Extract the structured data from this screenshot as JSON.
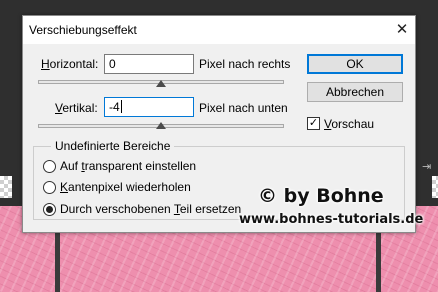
{
  "dialog": {
    "title": "Verschiebungseffekt",
    "close_symbol": "✕",
    "horizontal": {
      "label_accel": "H",
      "label_rest": "orizontal:",
      "value": "0",
      "unit_label": "Pixel nach rechts",
      "slider_level": 0.5
    },
    "vertical": {
      "label_accel": "V",
      "label_rest": "ertikal:",
      "value": "-4",
      "unit_label": "Pixel nach unten",
      "slider_level": 0.5
    },
    "buttons": {
      "ok": "OK",
      "cancel": "Abbrechen"
    },
    "preview": {
      "label_accel": "V",
      "label_rest": "orschau",
      "checked": true,
      "check_mark": "✓"
    },
    "undefined_areas": {
      "title": "Undefinierte Bereiche",
      "options": [
        {
          "label_before": "Auf ",
          "label_accel": "t",
          "label_after": "ransparent einstellen",
          "selected": false
        },
        {
          "label_before": "",
          "label_accel": "K",
          "label_after": "antenpixel wiederholen",
          "selected": false
        },
        {
          "label_before": "Durch verschobenen ",
          "label_accel": "T",
          "label_after": "eil ersetzen",
          "selected": true
        }
      ]
    }
  },
  "watermark": {
    "copyright": "© by Bohne",
    "url": "www.bohnes-tutorials.de"
  },
  "colors": {
    "focus_accent": "#0078d7",
    "canvas_pink": "#ee8fae",
    "workspace_dark": "#2f2f2f"
  }
}
